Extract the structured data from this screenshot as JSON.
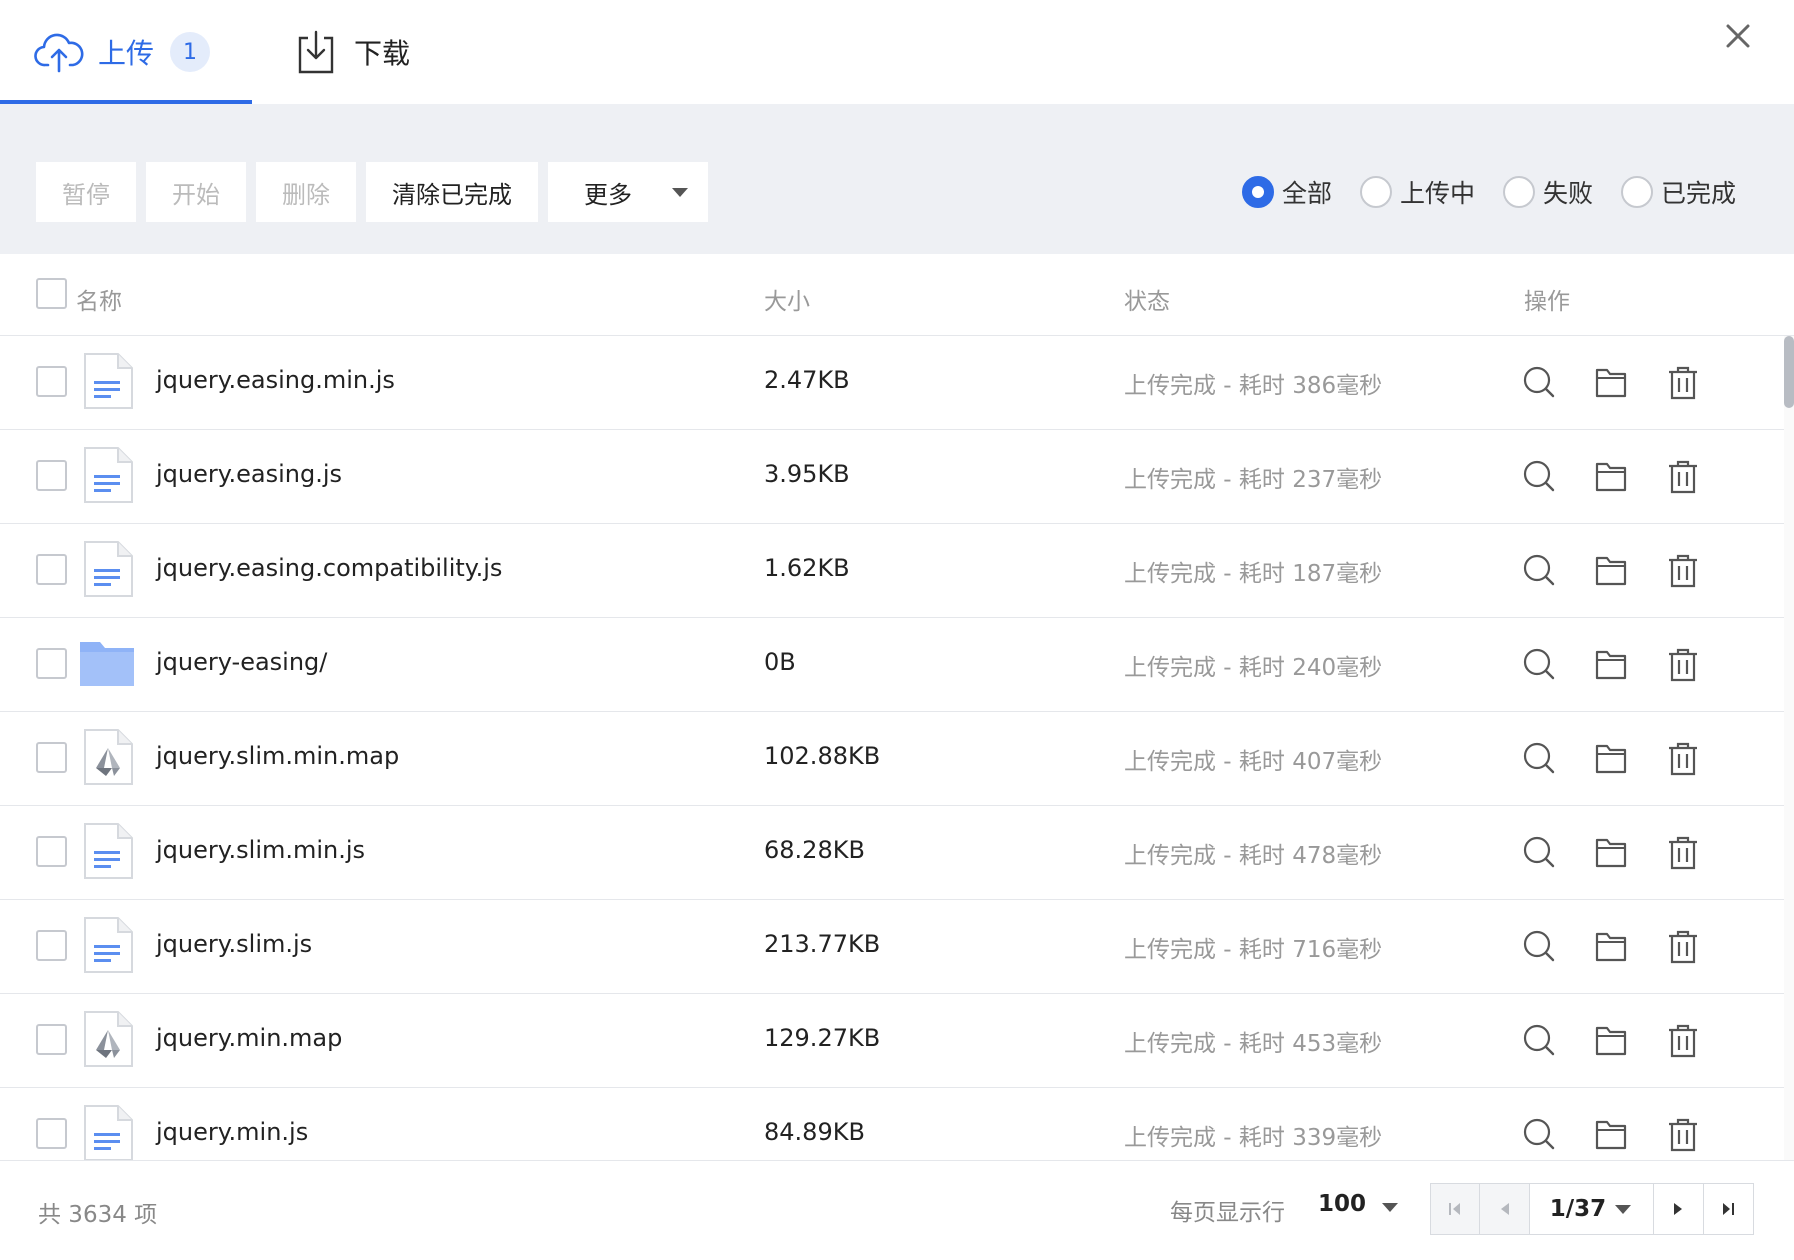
{
  "tabs": {
    "upload": {
      "label": "上传",
      "badge": "1",
      "icon": "cloud-upload-icon"
    },
    "download": {
      "label": "下载",
      "icon": "download-icon"
    }
  },
  "toolbar": {
    "pause_label": "暂停",
    "start_label": "开始",
    "delete_label": "删除",
    "clear_completed_label": "清除已完成",
    "more_label": "更多"
  },
  "filters": [
    {
      "label": "全部",
      "checked": true
    },
    {
      "label": "上传中",
      "checked": false
    },
    {
      "label": "失败",
      "checked": false
    },
    {
      "label": "已完成",
      "checked": false
    }
  ],
  "columns": {
    "name": "名称",
    "size": "大小",
    "status": "状态",
    "ops": "操作"
  },
  "rows": [
    {
      "name": "jquery.easing.min.js",
      "size": "2.47KB",
      "status": "上传完成 - 耗时 386毫秒",
      "type": "doc"
    },
    {
      "name": "jquery.easing.js",
      "size": "3.95KB",
      "status": "上传完成 - 耗时 237毫秒",
      "type": "doc"
    },
    {
      "name": "jquery.easing.compatibility.js",
      "size": "1.62KB",
      "status": "上传完成 - 耗时 187毫秒",
      "type": "doc"
    },
    {
      "name": "jquery-easing/",
      "size": "0B",
      "status": "上传完成 - 耗时 240毫秒",
      "type": "folder"
    },
    {
      "name": "jquery.slim.min.map",
      "size": "102.88KB",
      "status": "上传完成 - 耗时 407毫秒",
      "type": "map"
    },
    {
      "name": "jquery.slim.min.js",
      "size": "68.28KB",
      "status": "上传完成 - 耗时 478毫秒",
      "type": "doc"
    },
    {
      "name": "jquery.slim.js",
      "size": "213.77KB",
      "status": "上传完成 - 耗时 716毫秒",
      "type": "doc"
    },
    {
      "name": "jquery.min.map",
      "size": "129.27KB",
      "status": "上传完成 - 耗时 453毫秒",
      "type": "map"
    },
    {
      "name": "jquery.min.js",
      "size": "84.89KB",
      "status": "上传完成 - 耗时 339毫秒",
      "type": "doc"
    }
  ],
  "footer": {
    "total": "共 3634 项",
    "per_page_label": "每页显示行",
    "per_page_value": "100",
    "page_indicator": "1/37"
  },
  "colors": {
    "accent": "#2e6be6",
    "toolbar_bg": "#eef0f4",
    "muted_text": "#999999"
  }
}
